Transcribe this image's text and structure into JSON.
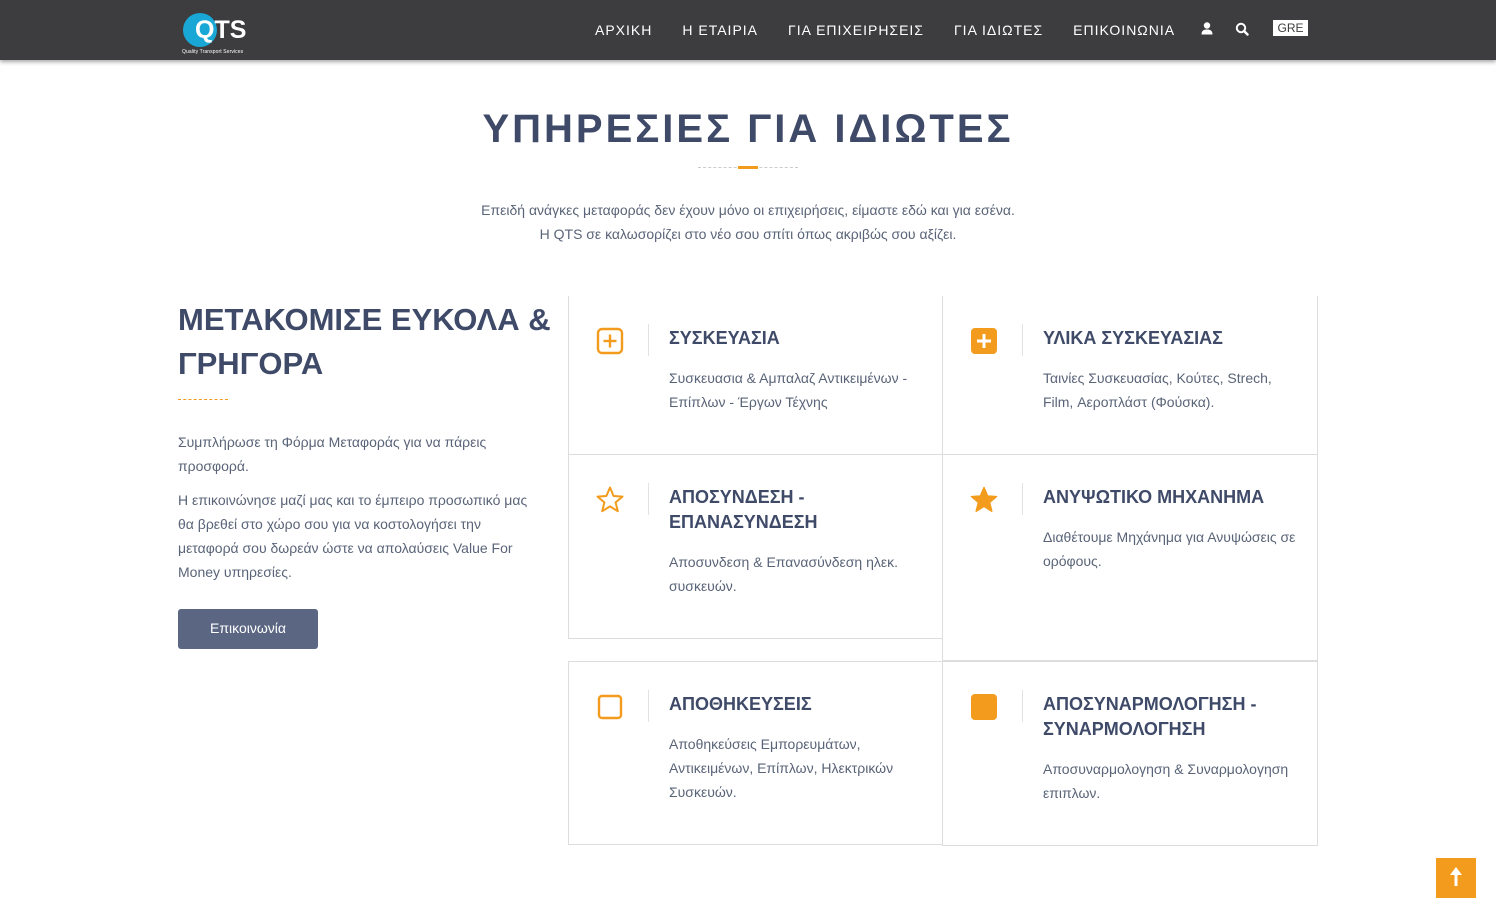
{
  "brand": {
    "logo_text": "QTS",
    "logo_subtitle": "Quality Transport Services",
    "logo_color": "#19a7d6",
    "accent_color": "#f29b1d",
    "navbar_color": "#3d3d3f"
  },
  "nav": {
    "items": [
      "ΑΡΧΙΚΗ",
      "Η ΕΤΑΙΡΙΑ",
      "ΓΙΑ ΕΠΙΧΕΙΡΗΣΕΙΣ",
      "ΓΙΑ ΙΔΙΩΤΕΣ",
      "ΕΠΙΚΟΙΝΩΝΙΑ"
    ],
    "user_icon": "user-icon",
    "search_icon": "search-icon",
    "language": "GRE"
  },
  "section": {
    "title": "ΥΠΗΡΕΣΙΕΣ ΓΙΑ ΙΔΙΩΤΕΣ",
    "intro": "Επειδή ανάγκες μεταφοράς δεν έχουν μόνο οι επιχειρήσεις, είμαστε εδώ και για εσένα. Η QTS σε καλωσορίζει στο νέο σου σπίτι όπως ακριβώς σου αξίζει."
  },
  "left": {
    "heading": "ΜΕΤΑΚΟΜΙΣΕ ΕΥΚΟΛΑ & ΓΡΗΓΟΡΑ",
    "paragraph1": "Συμπλήρωσε τη Φόρμα Μεταφοράς για να πάρεις προσφορά.",
    "paragraph2": "Η επικοινώνησε μαζί μας και το έμπειρο προσωπικό μας θα βρεθεί στο χώρο σου για να κοστολογήσει την μεταφορά σου δωρεάν ώστε να απολαύσεις Value For Money υπηρεσίες.",
    "button_label": "Επικοινωνία"
  },
  "services": [
    {
      "icon": "plus-square-outline-icon",
      "title": "ΣΥΣΚΕΥΑΣΙΑ",
      "description": "Συσκευασια & Αμπαλαζ Αντικειμένων - Επίπλων - Έργων Τέχνης"
    },
    {
      "icon": "plus-square-filled-icon",
      "title": "ΥΛΙΚΑ ΣΥΣΚΕΥΑΣΙΑΣ",
      "description": "Ταινίες Συσκευασίας, Κούτες, Strech, Film, Αεροπλάστ (Φούσκα)."
    },
    {
      "icon": "star-outline-icon",
      "title": "ΑΠΟΣΥΝΔΕΣΗ - ΕΠΑΝΑΣΥΝΔΕΣΗ",
      "description": "Αποσυνδεση & Επανασύνδεση ηλεκ. συσκευών."
    },
    {
      "icon": "star-filled-icon",
      "title": "ΑΝΥΨΩΤΙΚΟ ΜΗΧΑΝΗΜΑ",
      "description": "Διαθέτουμε Μηχάνημα για Ανυψώσεις σε ορόφους."
    },
    {
      "icon": "square-outline-icon",
      "title": "ΑΠΟΘΗΚΕΥΣΕΙΣ",
      "description": "Αποθηκεύσεις Εμπορευμάτων, Αντικειμένων, Επίπλων, Ηλεκτρικών Συσκευών."
    },
    {
      "icon": "square-filled-icon",
      "title": "ΑΠΟΣΥΝΑΡΜΟΛΟΓΗΣΗ - ΣΥΝΑΡΜΟΛΟΓΗΣΗ",
      "description": "Αποσυναρμολογηση & Συναρμολογηση επιπλων."
    }
  ],
  "scroll_top_icon": "arrow-up-icon"
}
